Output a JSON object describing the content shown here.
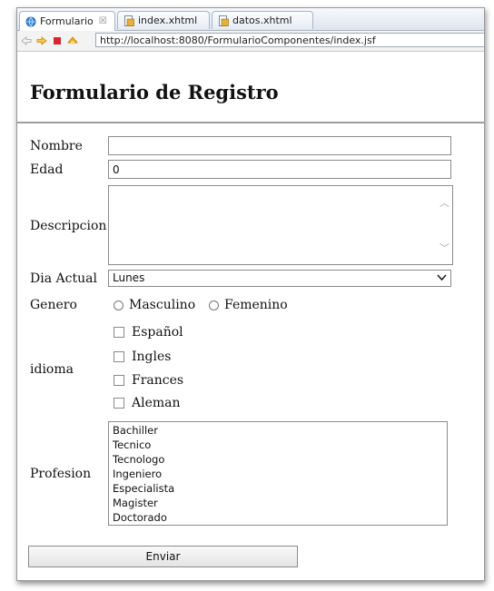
{
  "tabs": [
    {
      "label": "Formulario",
      "active": true,
      "icon": "globe-icon",
      "close": "☒"
    },
    {
      "label": "index.xhtml",
      "active": false,
      "icon": "xhtml-file-icon"
    },
    {
      "label": "datos.xhtml",
      "active": false,
      "icon": "xhtml-file-icon"
    }
  ],
  "address_bar": {
    "url": "http://localhost:8080/FormularioComponentes/index.jsf",
    "icons": [
      "back-icon",
      "forward-icon",
      "stop-icon",
      "refresh-icon"
    ]
  },
  "form": {
    "title": "Formulario de Registro",
    "nombre": {
      "label": "Nombre",
      "value": ""
    },
    "edad": {
      "label": "Edad",
      "value": "0"
    },
    "descripcion": {
      "label": "Descripcion",
      "value": ""
    },
    "dia_actual": {
      "label": "Dia Actual",
      "selected": "Lunes"
    },
    "genero": {
      "label": "Genero",
      "options": [
        "Masculino",
        "Femenino"
      ]
    },
    "idioma": {
      "label": "idioma",
      "options": [
        "Español",
        "Ingles",
        "Frances",
        "Aleman"
      ]
    },
    "profesion": {
      "label": "Profesion",
      "options": [
        "Bachiller",
        "Tecnico",
        "Tecnologo",
        "Ingeniero",
        "Especialista",
        "Magister",
        "Doctorado"
      ]
    },
    "submit_label": "Enviar"
  },
  "colors": {
    "accent": "#2a6fc9",
    "border": "#8b8b8b",
    "stop": "#d9262c",
    "nav_arrow": "#f2b01e"
  }
}
